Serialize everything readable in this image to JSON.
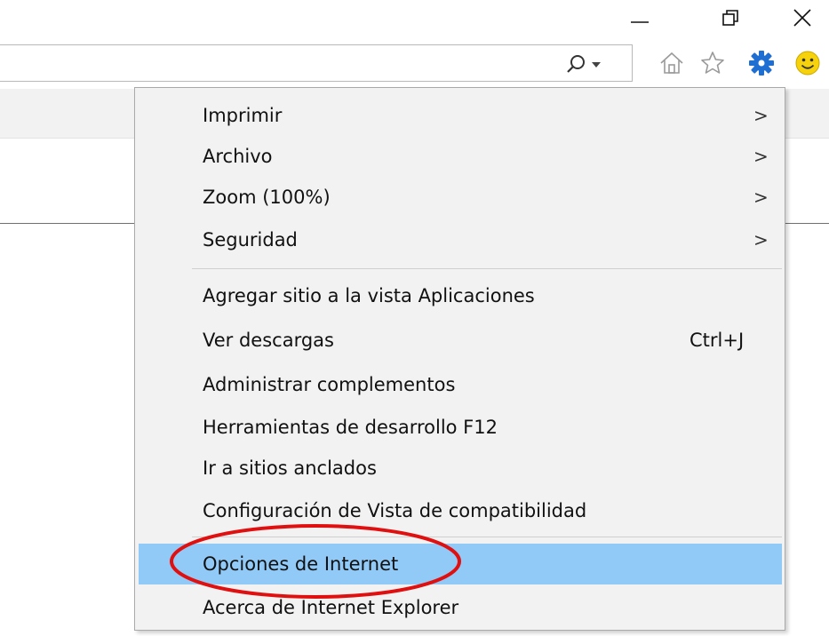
{
  "window_controls": {
    "minimize": "minimize-icon",
    "restore": "restore-icon",
    "close": "close-icon"
  },
  "address_bar": {
    "value": "",
    "search_icon": "search-icon",
    "dropdown_icon": "chevron-down-icon"
  },
  "toolbar": {
    "home_icon": "home-icon",
    "favorites_icon": "star-icon",
    "tools_icon": "gear-icon",
    "feedback_icon": "smiley-icon"
  },
  "colors": {
    "menu_bg": "#f2f2f2",
    "highlight": "#91c9f7",
    "gear_blue": "#1e6fd1",
    "smiley_yellow": "#f5d20b",
    "annotation_red": "#e01010"
  },
  "menu": {
    "items": [
      {
        "label": "Imprimir",
        "submenu": true,
        "shortcut": ""
      },
      {
        "label": "Archivo",
        "submenu": true,
        "shortcut": ""
      },
      {
        "label": "Zoom (100%)",
        "submenu": true,
        "shortcut": ""
      },
      {
        "label": "Seguridad",
        "submenu": true,
        "shortcut": ""
      },
      {
        "label": "Agregar sitio a la vista Aplicaciones",
        "submenu": false,
        "shortcut": ""
      },
      {
        "label": "Ver descargas",
        "submenu": false,
        "shortcut": "Ctrl+J"
      },
      {
        "label": "Administrar complementos",
        "submenu": false,
        "shortcut": ""
      },
      {
        "label": "Herramientas de desarrollo F12",
        "submenu": false,
        "shortcut": ""
      },
      {
        "label": "Ir a sitios anclados",
        "submenu": false,
        "shortcut": ""
      },
      {
        "label": "Configuración de Vista de compatibilidad",
        "submenu": false,
        "shortcut": ""
      },
      {
        "label": "Opciones de Internet",
        "submenu": false,
        "shortcut": "",
        "highlighted": true
      },
      {
        "label": "Acerca de Internet Explorer",
        "submenu": false,
        "shortcut": ""
      }
    ],
    "submenu_arrow": ">"
  }
}
